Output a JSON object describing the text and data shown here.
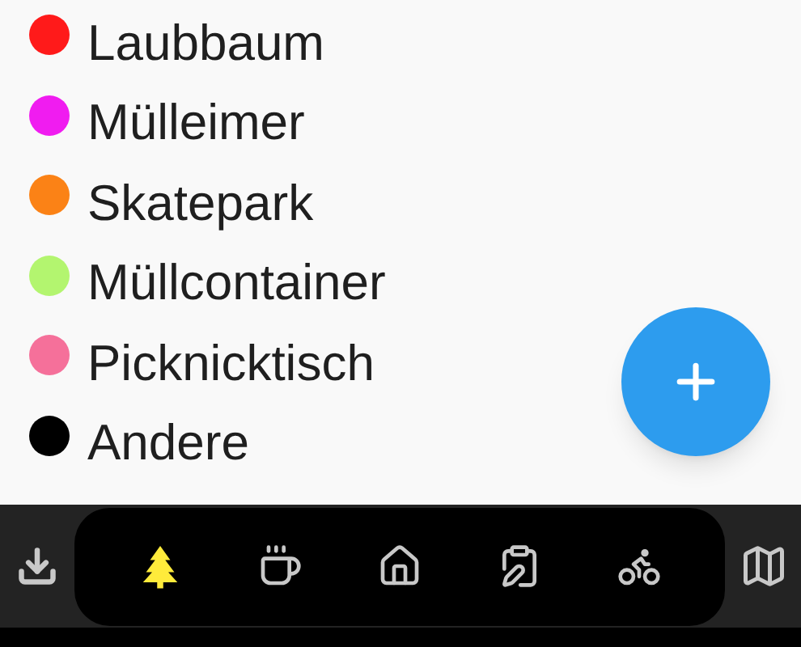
{
  "legend": [
    {
      "label": "Laubbaum",
      "color": "#ff1a1a"
    },
    {
      "label": "Mülleimer",
      "color": "#f01cf0"
    },
    {
      "label": "Skatepark",
      "color": "#fb8216"
    },
    {
      "label": "Müllcontainer",
      "color": "#b3f56f"
    },
    {
      "label": "Picknicktisch",
      "color": "#f5709a"
    },
    {
      "label": "Andere",
      "color": "#000000"
    }
  ],
  "bottom_bar": {
    "left_button": {
      "selected": false
    },
    "pill_items": [
      {
        "selected": true
      },
      {
        "selected": false
      },
      {
        "selected": false
      },
      {
        "selected": false
      },
      {
        "selected": false
      }
    ],
    "right_button": {
      "selected": false
    }
  }
}
